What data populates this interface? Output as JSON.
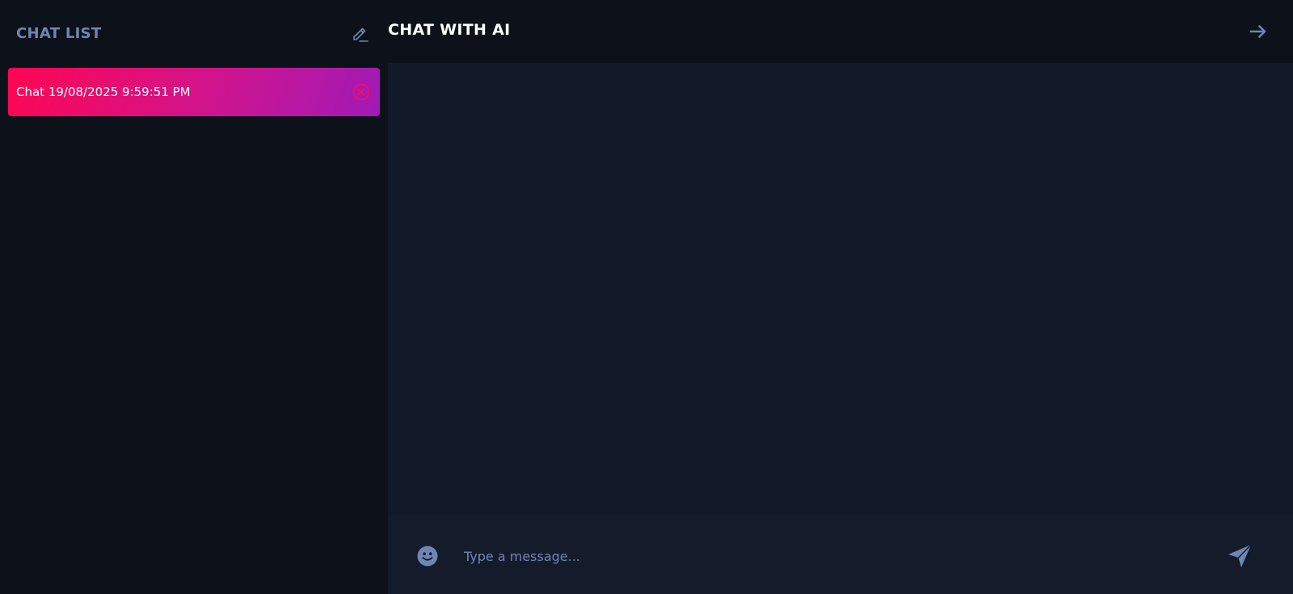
{
  "sidebar": {
    "title": "CHAT LIST",
    "new_chat_icon": "pencil-icon",
    "chats": [
      {
        "label": "Chat 19/08/2025 9:59:51 PM",
        "delete_icon": "close-circle-icon",
        "active": true
      }
    ]
  },
  "main": {
    "title": "CHAT WITH AI",
    "collapse_icon": "arrow-right-icon"
  },
  "composer": {
    "emoji_icon": "smiley-icon",
    "placeholder": "Type a message...",
    "value": "",
    "send_icon": "send-icon"
  },
  "colors": {
    "background": "#0d1119",
    "panel": "#121928",
    "accent_muted": "#6f86b4",
    "gradient_start": "#ff0652",
    "gradient_end": "#a01ab7"
  }
}
